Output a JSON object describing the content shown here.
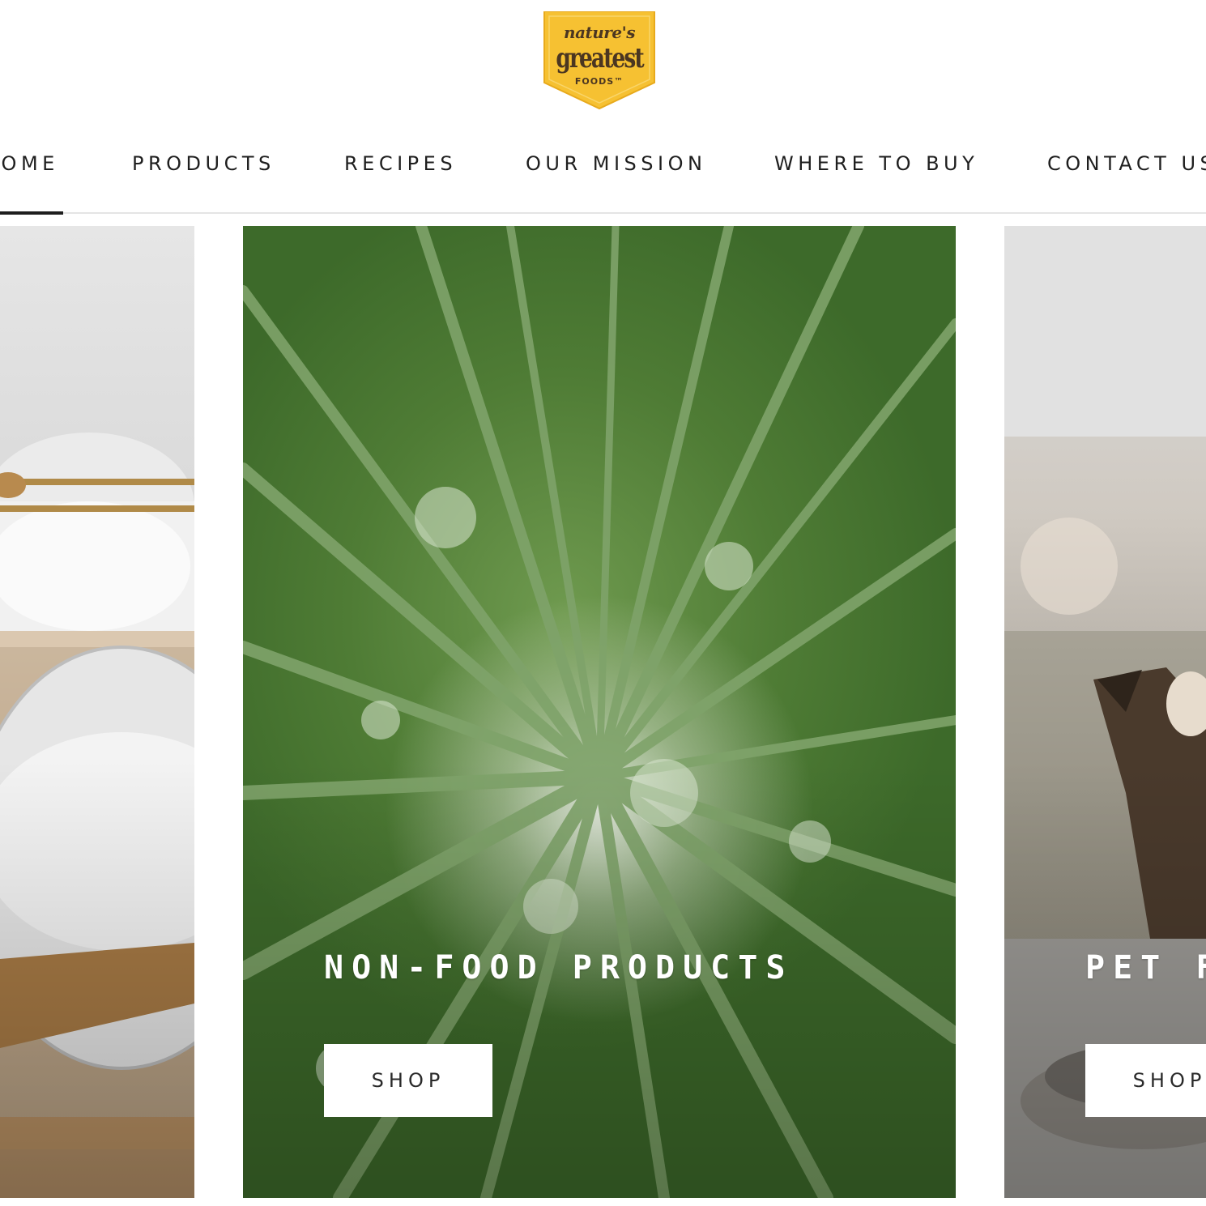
{
  "logo": {
    "line1": "nature's",
    "line2": "greatest",
    "line3": "FOODS™",
    "colors": {
      "badge": "#f6c132",
      "text": "#4b3621"
    }
  },
  "nav": {
    "items": [
      {
        "label": "HOME",
        "active": true
      },
      {
        "label": "PRODUCTS",
        "active": false
      },
      {
        "label": "RECIPES",
        "active": false
      },
      {
        "label": "OUR MISSION",
        "active": false
      },
      {
        "label": "WHERE TO BUY",
        "active": false
      },
      {
        "label": "CONTACT US",
        "active": false
      }
    ]
  },
  "cards": [
    {
      "image": "baking-ingredients-photo",
      "title": "",
      "button": ""
    },
    {
      "image": "bamboo-forest-photo",
      "title": "NON-FOOD PRODUCTS",
      "button": "SHOP"
    },
    {
      "image": "cat-with-bowl-photo",
      "title": "PET FOOD",
      "button": "SHOP"
    }
  ],
  "colors": {
    "nav_text": "#1e1e1e",
    "divider": "#e4e4e4",
    "button_bg": "#ffffff",
    "card_title": "#ffffff"
  }
}
